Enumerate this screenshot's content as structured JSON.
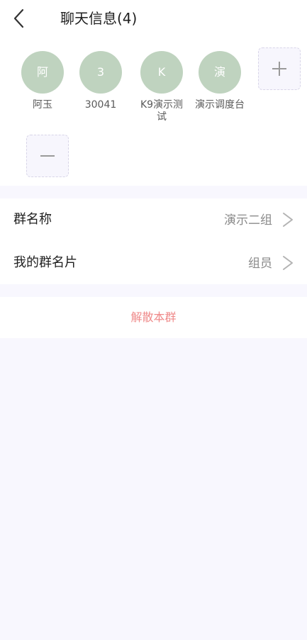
{
  "header": {
    "title": "聊天信息(4)"
  },
  "members": [
    {
      "avatar_text": "阿",
      "name": "阿玉"
    },
    {
      "avatar_text": "3",
      "name": "30041"
    },
    {
      "avatar_text": "K",
      "name": "K9演示测试"
    },
    {
      "avatar_text": "演",
      "name": "演示调度台"
    }
  ],
  "settings": {
    "group_name": {
      "label": "群名称",
      "value": "演示二组"
    },
    "my_card": {
      "label": "我的群名片",
      "value": "组员"
    }
  },
  "dissolve_label": "解散本群",
  "colors": {
    "avatar_bg": "#bfd3bf",
    "danger": "#ef8a8a",
    "page_bg": "#f8f7fe"
  },
  "icons": {
    "back": "chevron-left-icon",
    "add": "plus-icon",
    "remove": "minus-icon",
    "row_arrow": "chevron-right-icon"
  }
}
